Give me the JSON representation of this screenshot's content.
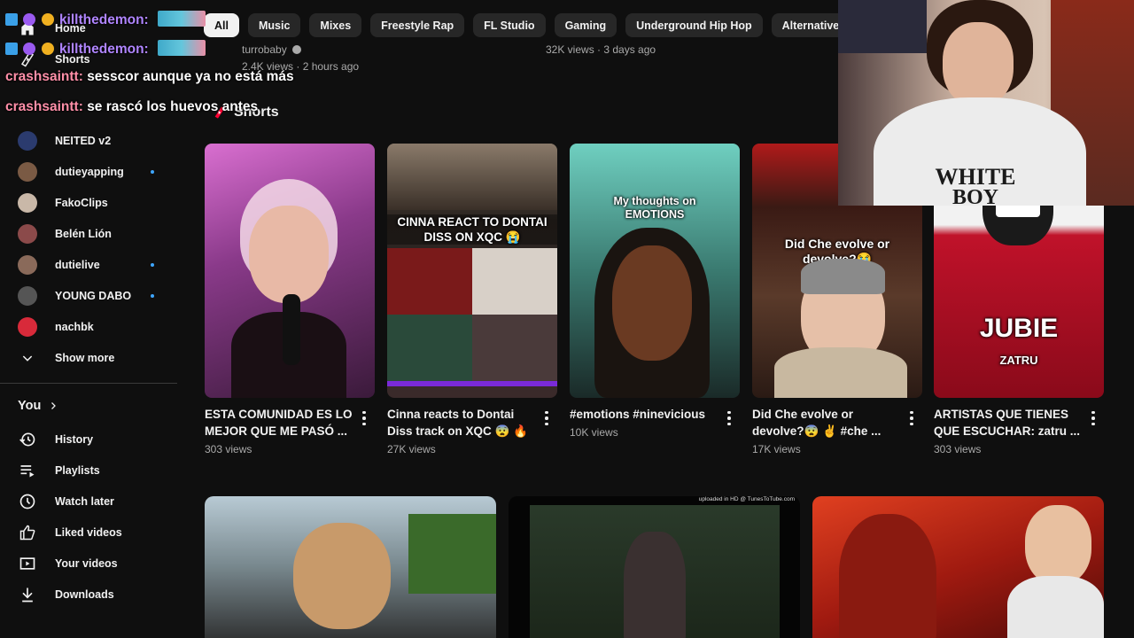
{
  "sidebar": {
    "home_label": "Home",
    "shorts_label": "Shorts",
    "subscriptions": [
      {
        "name": "NEITED v2",
        "avatar_color": "#2b3b6e",
        "live": false
      },
      {
        "name": "dutieyapping",
        "avatar_color": "#7a5a44",
        "live": true
      },
      {
        "name": "FakoClips",
        "avatar_color": "#c9b8a8",
        "live": false
      },
      {
        "name": "Belén Lión",
        "avatar_color": "#8b4a4a",
        "live": false
      },
      {
        "name": "dutielive",
        "avatar_color": "#8a6a5a",
        "live": true
      },
      {
        "name": "YOUNG DABO",
        "avatar_color": "#555555",
        "live": true
      },
      {
        "name": "nachbk",
        "avatar_color": "#d82a3a",
        "live": false
      }
    ],
    "show_more_label": "Show more",
    "you_label": "You",
    "you_items": [
      {
        "label": "History",
        "icon": "history-icon"
      },
      {
        "label": "Playlists",
        "icon": "playlists-icon"
      },
      {
        "label": "Watch later",
        "icon": "watch-later-icon"
      },
      {
        "label": "Liked videos",
        "icon": "like-icon"
      },
      {
        "label": "Your videos",
        "icon": "your-videos-icon"
      },
      {
        "label": "Downloads",
        "icon": "download-icon"
      }
    ]
  },
  "chips": [
    "All",
    "Music",
    "Mixes",
    "Freestyle Rap",
    "FL Studio",
    "Gaming",
    "Underground Hip Hop",
    "Alternative Hip Hop"
  ],
  "previous_row": {
    "channel": "turrobaby",
    "left_meta": "2.4K views · 2 hours ago",
    "right_meta": "32K views · 3 days ago"
  },
  "shorts": {
    "heading": "Shorts",
    "items": [
      {
        "title": "ESTA COMUNIDAD ES LO MEJOR QUE ME PASÓ ...",
        "views": "303 views",
        "caption": "",
        "color_a": "#c85fb8",
        "color_b": "#3a1a3a"
      },
      {
        "title": "Cinna reacts to Dontai Diss track on XQC 😨 🔥",
        "views": "27K views",
        "caption": "CINNA REACT TO DONTAI DISS ON XQC 😭",
        "color_a": "#5a4a40",
        "color_b": "#2a2a2a"
      },
      {
        "title": "#emotions #ninevicious",
        "views": "10K views",
        "caption": "My thoughts on EMOTIONS",
        "color_a": "#5fbfb0",
        "color_b": "#2a4a44"
      },
      {
        "title": "Did Che evolve or devolve?😨 ✌ #che ...",
        "views": "17K views",
        "caption": "Did Che evolve or devolve?😭",
        "color_a": "#8a2a2a",
        "color_b": "#c9b8a8"
      },
      {
        "title": "ARTISTAS QUE TIENES QUE ESCUCHAR: zatru ...",
        "views": "303 views",
        "caption": "JUBIE",
        "sub_caption": "ZATRU",
        "color_a": "#e8e8e8",
        "color_b": "#b0102a"
      }
    ]
  },
  "videos": [
    {
      "color_a": "#9fb8c8",
      "color_b": "#3a3a3a"
    },
    {
      "color_a": "#2a3a2a",
      "color_b": "#0a0a0a",
      "watermark": "uploaded in HD @ TunesToTube.com"
    },
    {
      "color_a": "#c0301a",
      "color_b": "#5a1008"
    }
  ],
  "webcam": {
    "shirt_text_1": "WHITE",
    "shirt_text_2": "BOY"
  },
  "chat": [
    {
      "user": "killthedemon:",
      "user_color": "#b085ff",
      "message": "",
      "emote": true
    },
    {
      "user": "killthedemon:",
      "user_color": "#b085ff",
      "message": "",
      "emote": true
    },
    {
      "user": "crashsaintt:",
      "user_color": "#ff8fa8",
      "message": "sesscor aunque ya no está más",
      "emote": false
    },
    {
      "user": "crashsaintt:",
      "user_color": "#ff8fa8",
      "message": "se rascó los huevos antes",
      "emote": false
    }
  ]
}
